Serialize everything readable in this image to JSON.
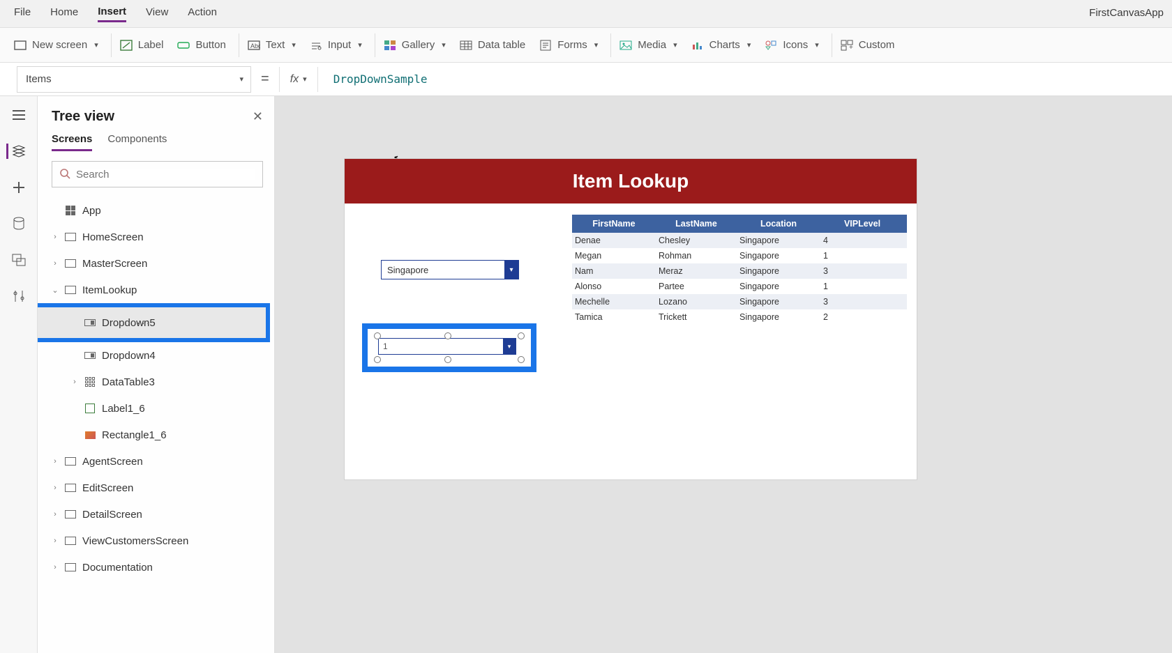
{
  "app_title": "FirstCanvasApp",
  "menubar": [
    "File",
    "Home",
    "Insert",
    "View",
    "Action"
  ],
  "menubar_active": 2,
  "ribbon": {
    "new_screen": "New screen",
    "label": "Label",
    "button": "Button",
    "text": "Text",
    "input": "Input",
    "gallery": "Gallery",
    "data_table": "Data table",
    "forms": "Forms",
    "media": "Media",
    "charts": "Charts",
    "icons": "Icons",
    "custom": "Custom"
  },
  "formula": {
    "property": "Items",
    "fx": "fx",
    "value": "DropDownSample"
  },
  "tree": {
    "title": "Tree view",
    "tabs": {
      "screens": "Screens",
      "components": "Components"
    },
    "search_placeholder": "Search",
    "app": "App",
    "screens": [
      {
        "name": "HomeScreen"
      },
      {
        "name": "MasterScreen"
      },
      {
        "name": "ItemLookup",
        "expanded": true,
        "children": [
          {
            "name": "Dropdown5",
            "type": "dropdown",
            "selected": true
          },
          {
            "name": "Dropdown4",
            "type": "dropdown"
          },
          {
            "name": "DataTable3",
            "type": "datatable",
            "hasChildren": true
          },
          {
            "name": "Label1_6",
            "type": "label"
          },
          {
            "name": "Rectangle1_6",
            "type": "rectangle"
          }
        ]
      },
      {
        "name": "AgentScreen"
      },
      {
        "name": "EditScreen"
      },
      {
        "name": "DetailScreen"
      },
      {
        "name": "ViewCustomersScreen"
      },
      {
        "name": "Documentation"
      }
    ]
  },
  "canvas": {
    "header_label": "Item Lookup",
    "dropdown1_value": "Singapore",
    "dropdown2_value": "1",
    "table": {
      "columns": [
        "FirstName",
        "LastName",
        "Location",
        "VIPLevel"
      ],
      "rows": [
        [
          "Denae",
          "Chesley",
          "Singapore",
          "4"
        ],
        [
          "Megan",
          "Rohman",
          "Singapore",
          "1"
        ],
        [
          "Nam",
          "Meraz",
          "Singapore",
          "3"
        ],
        [
          "Alonso",
          "Partee",
          "Singapore",
          "1"
        ],
        [
          "Mechelle",
          "Lozano",
          "Singapore",
          "3"
        ],
        [
          "Tamica",
          "Trickett",
          "Singapore",
          "2"
        ]
      ]
    }
  }
}
